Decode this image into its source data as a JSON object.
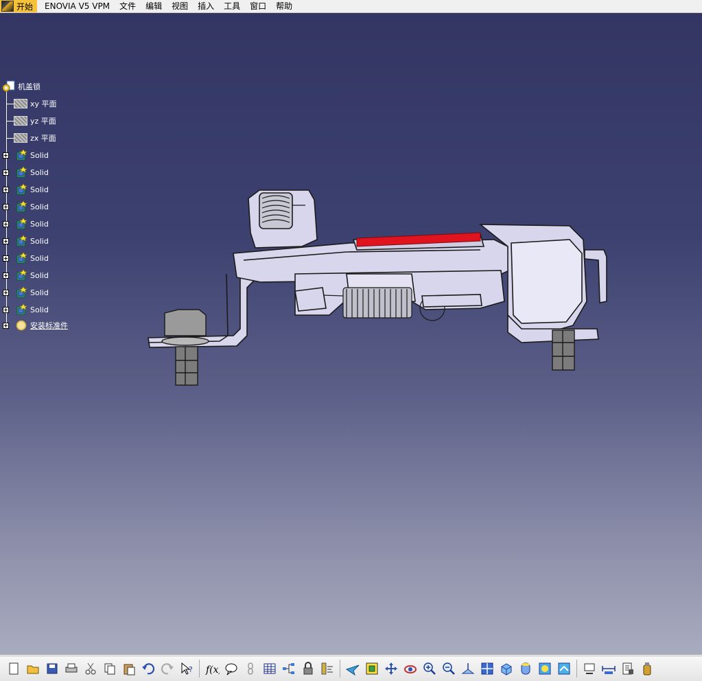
{
  "menubar": {
    "start": "开始",
    "items": [
      "ENOVIA V5 VPM",
      "文件",
      "编辑",
      "视图",
      "插入",
      "工具",
      "窗口",
      "帮助"
    ]
  },
  "tree": {
    "root": "机盖锁",
    "planes": [
      "xy 平面",
      "yz 平面",
      "zx 平面"
    ],
    "solids": [
      "Solid",
      "Solid",
      "Solid",
      "Solid",
      "Solid",
      "Solid",
      "Solid",
      "Solid",
      "Solid",
      "Solid"
    ],
    "assembly": "安装标准件"
  },
  "colors": {
    "viewport_top": "#333663",
    "viewport_bottom": "#a9abbf",
    "part_fill": "#d8d6ec",
    "part_highlight": "#e0141e",
    "bolt": "#8c8c8c"
  },
  "toolbar": {
    "buttons": [
      "new-icon",
      "open-icon",
      "save-icon",
      "print-icon",
      "cut-icon",
      "copy-icon",
      "paste-icon",
      "undo-icon",
      "redo-icon",
      "whats-this-icon",
      "formula-icon",
      "comment-icon",
      "link-icon",
      "table-icon",
      "tree-icon",
      "lock-icon",
      "knowledge-icon",
      "fly-mode-icon",
      "fit-all-icon",
      "pan-icon",
      "rotate-icon",
      "zoom-in-icon",
      "zoom-out-icon",
      "normal-view-icon",
      "multi-view-icon",
      "iso-view-icon",
      "shading-icon",
      "material-icon",
      "hide-show-icon",
      "swap-icon",
      "measure-icon",
      "properties-icon",
      "apply-material-icon"
    ]
  }
}
